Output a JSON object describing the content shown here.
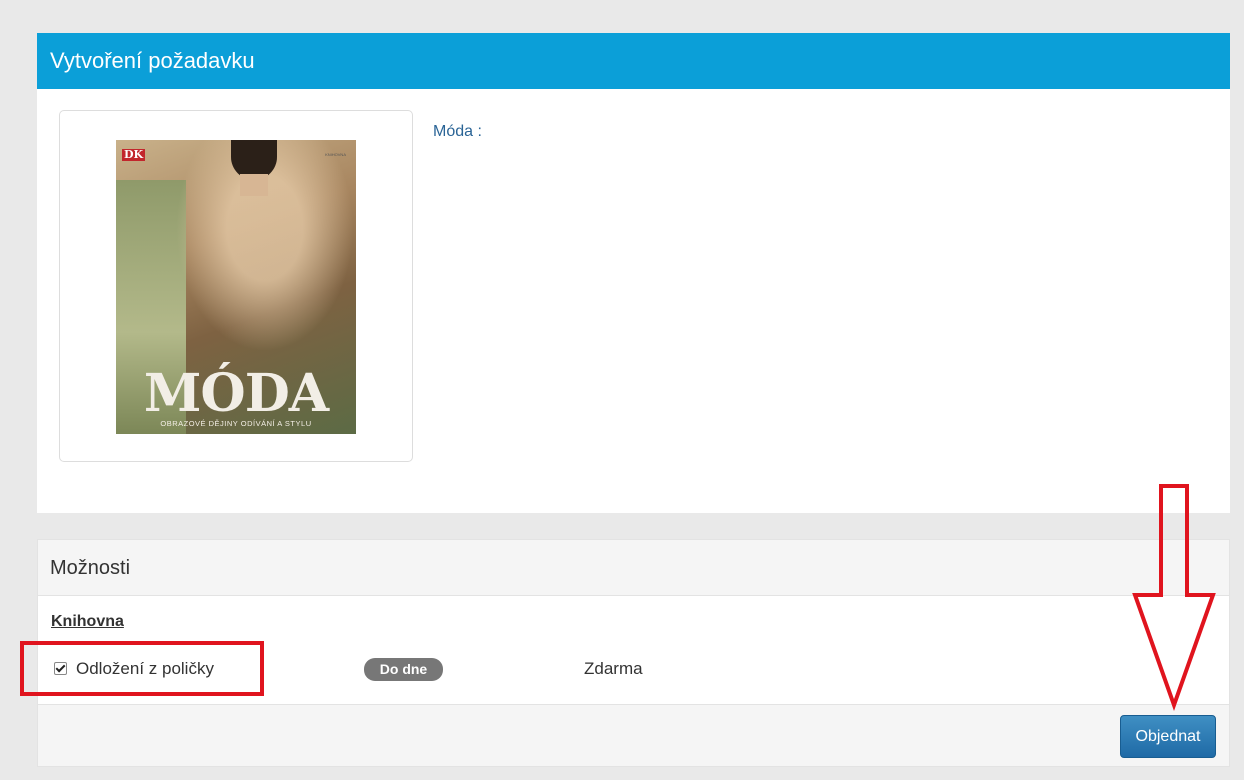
{
  "request_panel": {
    "title": "Vytvoření požadavku",
    "item_label": "Móda :",
    "cover": {
      "publisher_logo": "DK",
      "publisher_text": "KNIHOVNA",
      "title": "MÓDA",
      "subtitle": "OBRAZOVÉ DĚJINY ODÍVÁNÍ A STYLU"
    }
  },
  "options_panel": {
    "title": "Možnosti",
    "library_title": "Knihovna",
    "option": {
      "checked": true,
      "label": "Odložení z poličky",
      "badge": "Do dne",
      "price": "Zdarma"
    },
    "order_button": "Objednat"
  },
  "colors": {
    "header_blue": "#0b9fd8",
    "button_blue": "#1f6aa6",
    "annotation_red": "#e0141e",
    "badge_gray": "#777777"
  }
}
